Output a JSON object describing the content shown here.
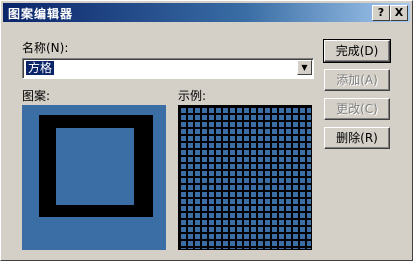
{
  "window": {
    "title": "图案编辑器",
    "help_label": "?",
    "close_label": "X"
  },
  "name_field": {
    "label": "名称(N):",
    "value": "方格"
  },
  "pattern_label": "图案:",
  "sample_label": "示例:",
  "buttons": {
    "done": "完成(D)",
    "add": "添加(A)",
    "change": "更改(C)",
    "delete": "删除(R)"
  },
  "colors": {
    "desktop_blue": "#3a6ea5",
    "pattern_black": "#000000",
    "dialog_face": "#d4d0c8"
  }
}
